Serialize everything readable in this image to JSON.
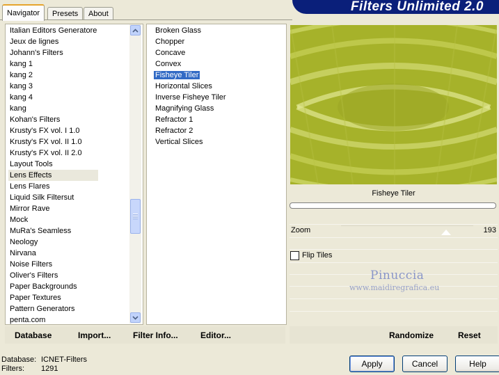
{
  "tabs": [
    "Navigator",
    "Presets",
    "About"
  ],
  "app_title": "Filters Unlimited 2.0",
  "categories": [
    "Italian Editors Generatore",
    "Jeux de lignes",
    "Johann's Filters",
    "kang 1",
    "kang 2",
    "kang 3",
    "kang 4",
    "kang",
    "Kohan's Filters",
    "Krusty's FX vol. I 1.0",
    "Krusty's FX vol. II 1.0",
    "Krusty's FX vol. II 2.0",
    "Layout Tools",
    "Lens Effects",
    "Lens Flares",
    "Liquid Silk Filtersut",
    "Mirror Rave",
    "Mock",
    "MuRa's Seamless",
    "Neology",
    "Nirvana",
    "Noise Filters",
    "Oliver's Filters",
    "Paper Backgrounds",
    "Paper Textures",
    "Pattern Generators",
    "penta.com"
  ],
  "selected_category": "Lens Effects",
  "filters": [
    "Broken Glass",
    "Chopper",
    "Concave",
    "Convex",
    "Fisheye Tiler",
    "Horizontal Slices",
    "Inverse Fisheye Tiler",
    "Magnifying Glass",
    "Refractor 1",
    "Refractor 2",
    "Vertical Slices"
  ],
  "selected_filter": "Fisheye Tiler",
  "preview": {
    "filter_name": "Fisheye Tiler"
  },
  "controls": {
    "zoom_label": "Zoom",
    "zoom_value": "193",
    "flip_tiles_label": "Flip Tiles",
    "flip_tiles_checked": false
  },
  "watermark": {
    "line1": "Pinuccia",
    "line2": "www.maidiregrafica.eu"
  },
  "left_links": {
    "database": "Database",
    "import": "Import...",
    "filter_info": "Filter Info...",
    "editor": "Editor..."
  },
  "right_links": {
    "randomize": "Randomize",
    "reset": "Reset"
  },
  "status": {
    "database_label": "Database:",
    "database_value": "ICNET-Filters",
    "filters_label": "Filters:",
    "filters_value": "1291"
  },
  "buttons": {
    "apply": "Apply",
    "cancel": "Cancel",
    "help": "Help"
  },
  "colors": {
    "preview_base": "#A9B52D",
    "banner": "#0A1F7A",
    "selection": "#316AC5"
  }
}
